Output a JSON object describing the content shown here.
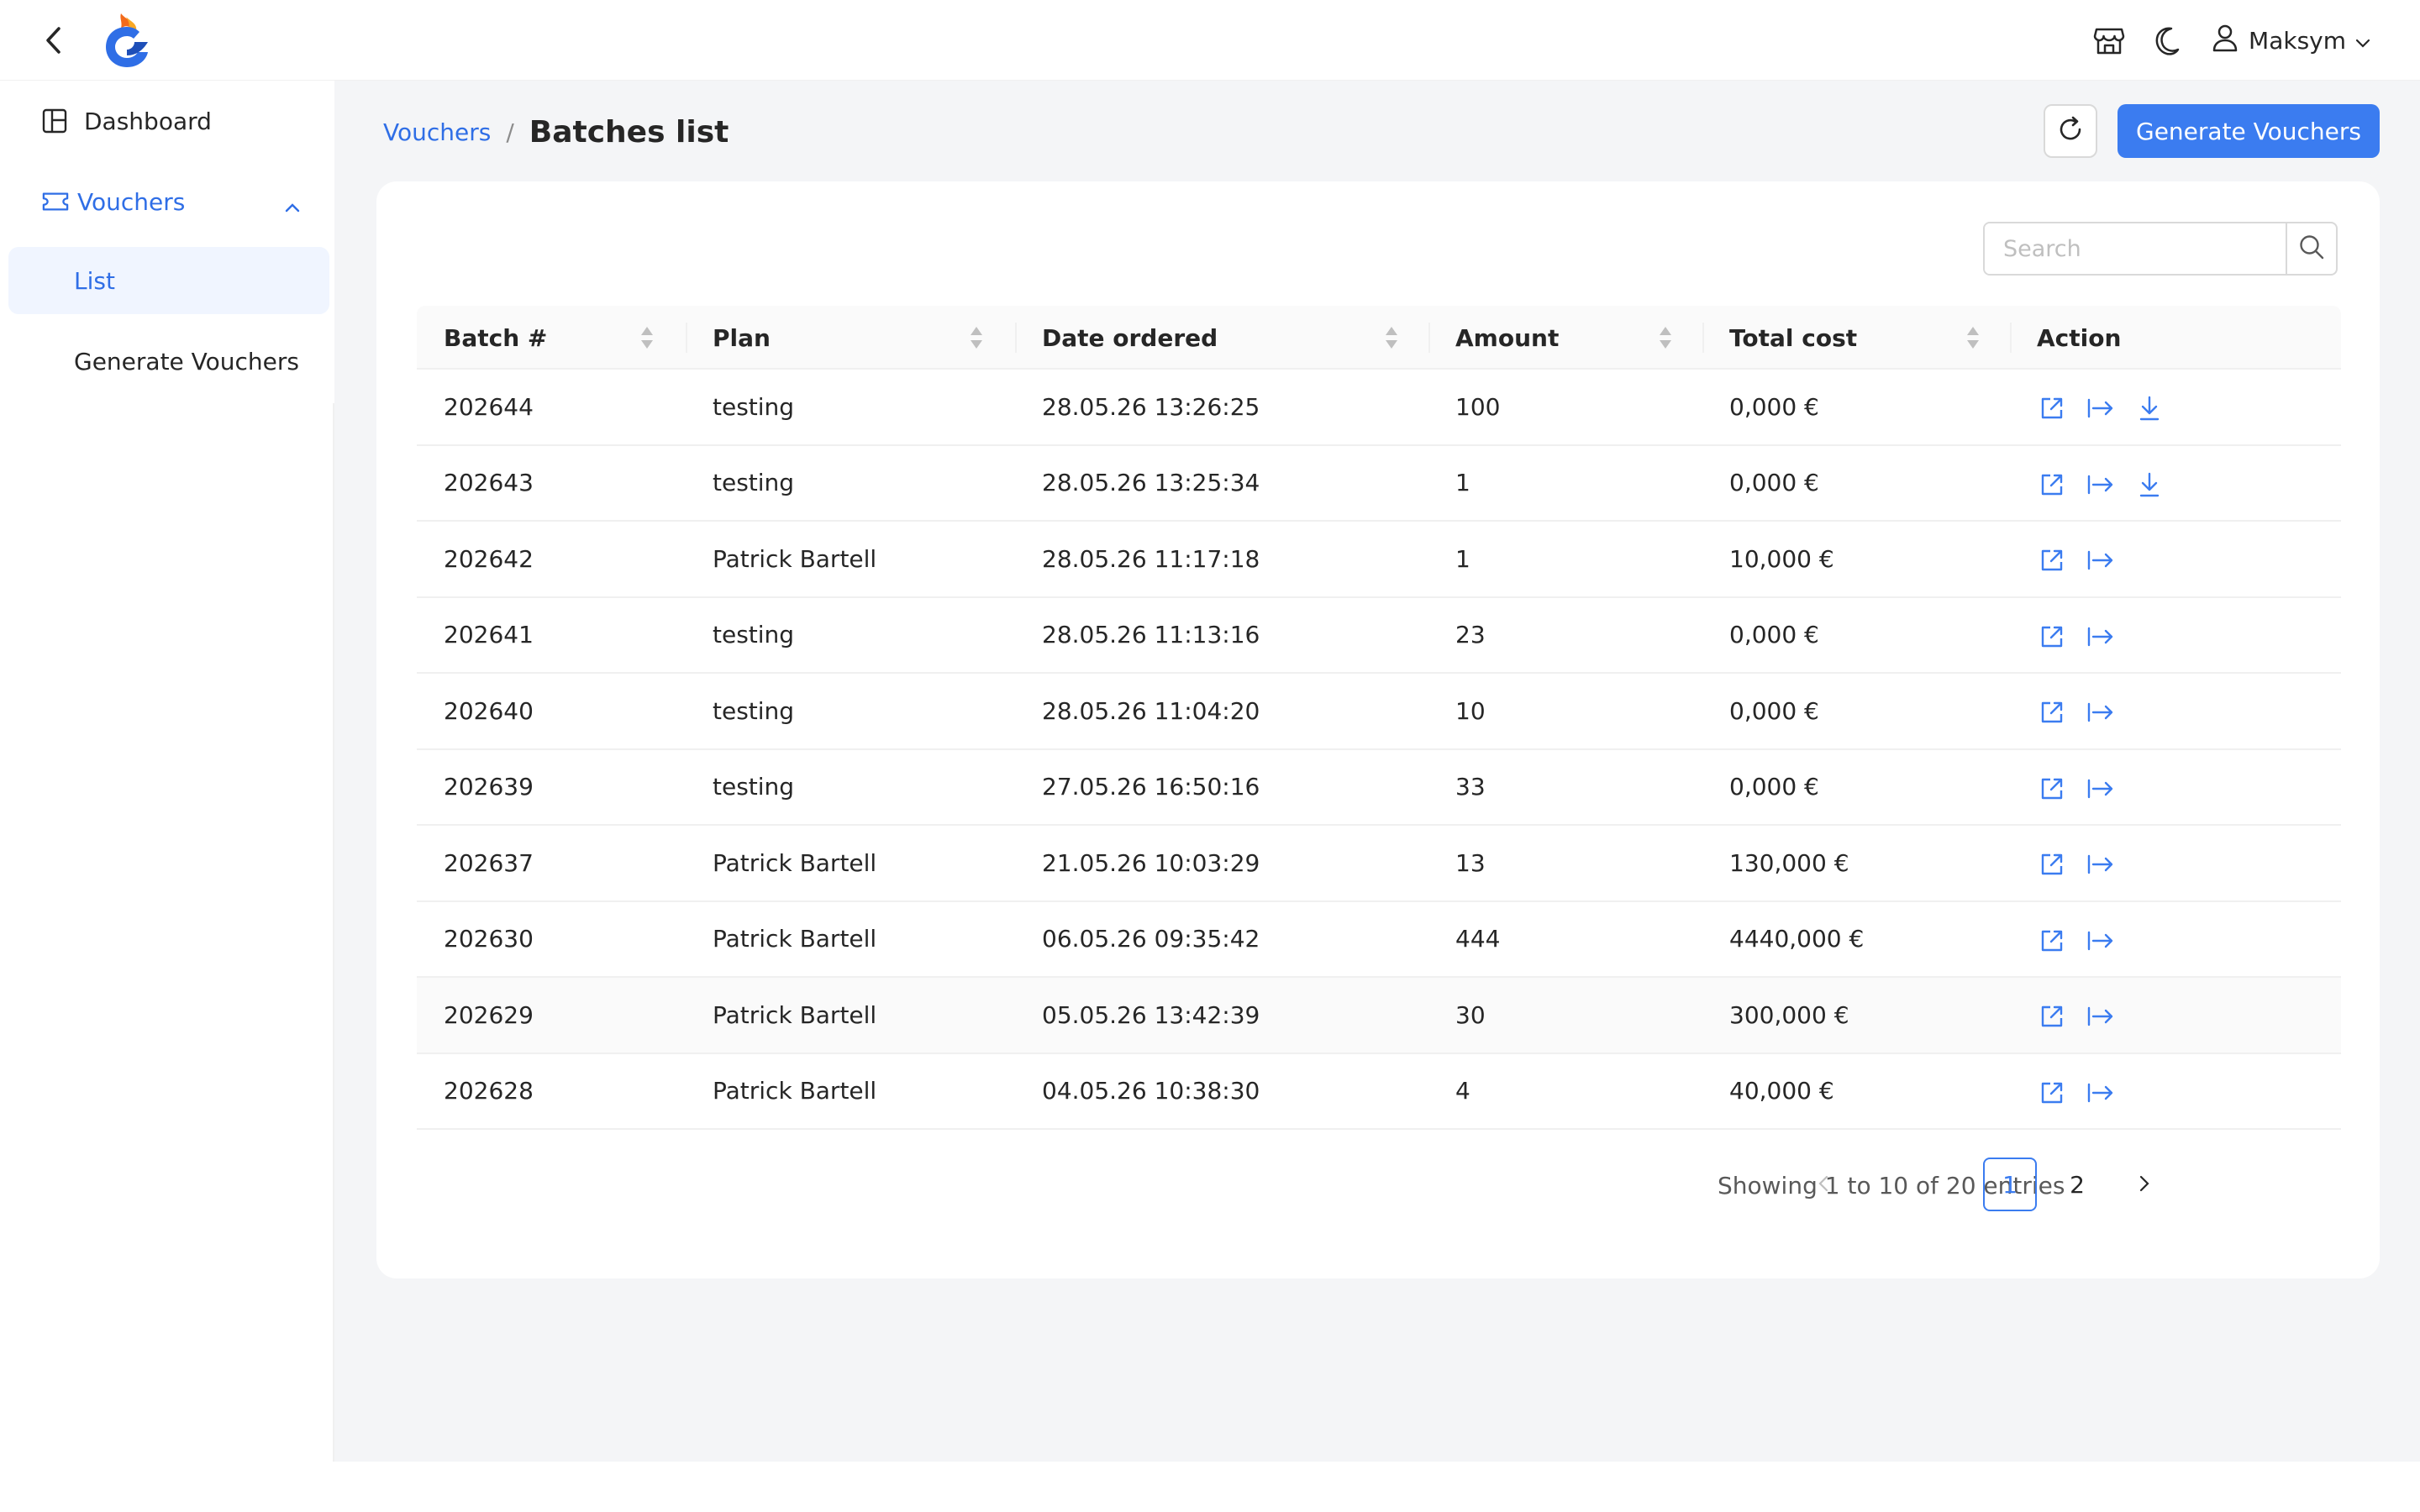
{
  "header": {
    "user_name": "Maksym",
    "icons": [
      "back-chevron-icon",
      "store-icon",
      "moon-icon",
      "user-icon",
      "chevron-down-icon"
    ]
  },
  "sidebar": {
    "items": [
      {
        "label": "Dashboard",
        "icon": "dashboard-icon"
      },
      {
        "label": "Vouchers",
        "icon": "ticket-icon",
        "expanded": true
      }
    ],
    "sub_items": [
      {
        "label": "List",
        "selected": true
      },
      {
        "label": "Generate Vouchers",
        "selected": false
      }
    ]
  },
  "breadcrumb": {
    "parent": "Vouchers",
    "separator": "/",
    "current": "Batches list"
  },
  "toolbar": {
    "generate_label": "Generate Vouchers"
  },
  "search": {
    "placeholder": "Search",
    "value": ""
  },
  "table": {
    "columns": [
      "Batch #",
      "Plan",
      "Date ordered",
      "Amount",
      "Total cost",
      "Action"
    ],
    "rows": [
      {
        "batch": "202644",
        "plan": "testing",
        "date": "28.05.26 13:26:25",
        "amount": "100",
        "cost": "0,000 €",
        "download": true
      },
      {
        "batch": "202643",
        "plan": "testing",
        "date": "28.05.26 13:25:34",
        "amount": "1",
        "cost": "0,000 €",
        "download": true
      },
      {
        "batch": "202642",
        "plan": "Patrick Bartell",
        "date": "28.05.26 11:17:18",
        "amount": "1",
        "cost": "10,000 €",
        "download": false
      },
      {
        "batch": "202641",
        "plan": "testing",
        "date": "28.05.26 11:13:16",
        "amount": "23",
        "cost": "0,000 €",
        "download": false
      },
      {
        "batch": "202640",
        "plan": "testing",
        "date": "28.05.26 11:04:20",
        "amount": "10",
        "cost": "0,000 €",
        "download": false
      },
      {
        "batch": "202639",
        "plan": "testing",
        "date": "27.05.26 16:50:16",
        "amount": "33",
        "cost": "0,000 €",
        "download": false
      },
      {
        "batch": "202637",
        "plan": "Patrick Bartell",
        "date": "21.05.26 10:03:29",
        "amount": "13",
        "cost": "130,000 €",
        "download": false
      },
      {
        "batch": "202630",
        "plan": "Patrick Bartell",
        "date": "06.05.26 09:35:42",
        "amount": "444",
        "cost": "4440,000 €",
        "download": false
      },
      {
        "batch": "202629",
        "plan": "Patrick Bartell",
        "date": "05.05.26 13:42:39",
        "amount": "30",
        "cost": "300,000 €",
        "download": false
      },
      {
        "batch": "202628",
        "plan": "Patrick Bartell",
        "date": "04.05.26 10:38:30",
        "amount": "4",
        "cost": "40,000 €",
        "download": false
      }
    ]
  },
  "pagination": {
    "info": "Showing 1 to 10 of 20 entries",
    "pages": [
      "1",
      "2"
    ],
    "current": "1"
  },
  "colors": {
    "accent": "#3b7cf0",
    "link": "#2f6ee6",
    "background": "#f4f5f7"
  }
}
